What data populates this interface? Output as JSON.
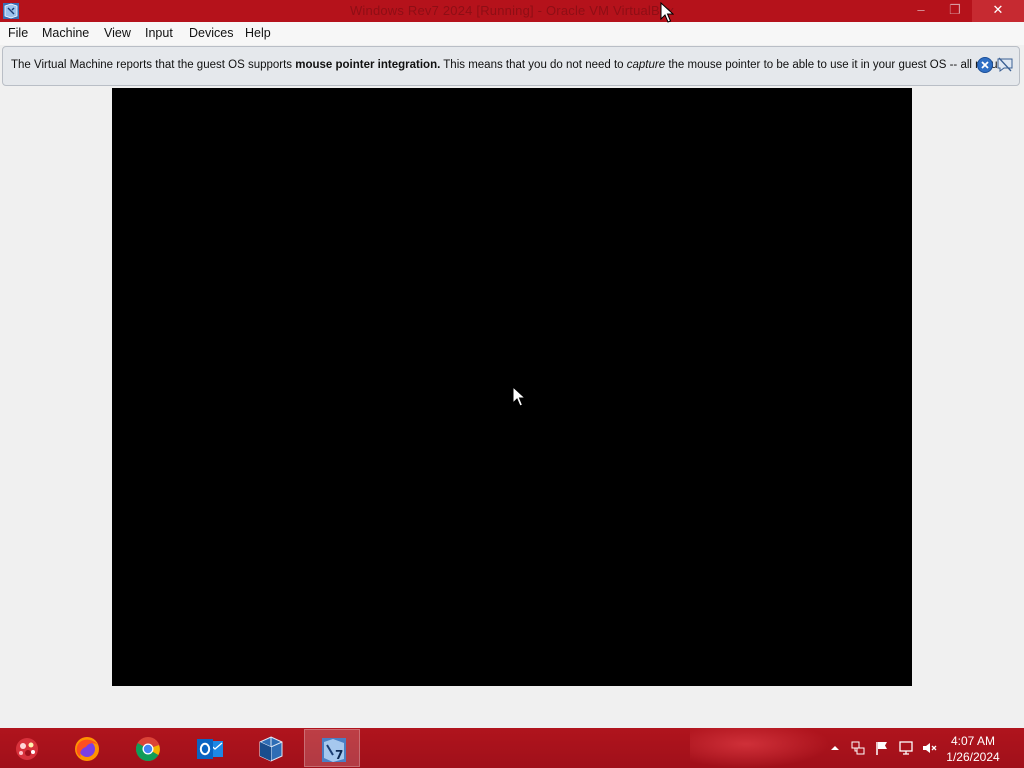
{
  "window": {
    "title": "Windows Rev7 2024 [Running] - Oracle VM VirtualBox",
    "minimize_label": "–",
    "maximize_label": "❐",
    "close_label": "✕"
  },
  "menu": {
    "items": [
      {
        "label": "File"
      },
      {
        "label": "Machine"
      },
      {
        "label": "View"
      },
      {
        "label": "Input"
      },
      {
        "label": "Devices"
      },
      {
        "label": "Help"
      }
    ]
  },
  "notification": {
    "text_1": "The Virtual Machine reports that the guest OS supports ",
    "text_bold": "mouse pointer integration.",
    "text_2": " This means that you do not need to ",
    "text_italic": "capture",
    "text_3": " the mouse pointer to be able to use it in your guest OS -- all mouse",
    "close_icon": "close-circle-icon",
    "dont_show_icon": "speech-bubble-off-icon"
  },
  "guest": {
    "screen_color": "#000000"
  },
  "taskbar": {
    "start_icon": "start-orb-icon",
    "pinned": [
      {
        "name": "firefox",
        "icon": "firefox-icon"
      },
      {
        "name": "chrome",
        "icon": "chrome-icon"
      },
      {
        "name": "outlook",
        "icon": "outlook-icon"
      },
      {
        "name": "virtualbox",
        "icon": "virtualbox-icon"
      },
      {
        "name": "vm-window",
        "icon": "virtualbox-vm-icon",
        "active": true
      }
    ],
    "tray": [
      "show-hidden-icons-chevron",
      "network-monitor-icon",
      "action-center-flag-icon",
      "network-icon",
      "volume-muted-icon"
    ],
    "time": "4:07 AM",
    "date": "1/26/2024"
  },
  "colors": {
    "titlebar": "#b5121b",
    "taskbar": "#a8121b",
    "close_button": "#c62a31"
  }
}
